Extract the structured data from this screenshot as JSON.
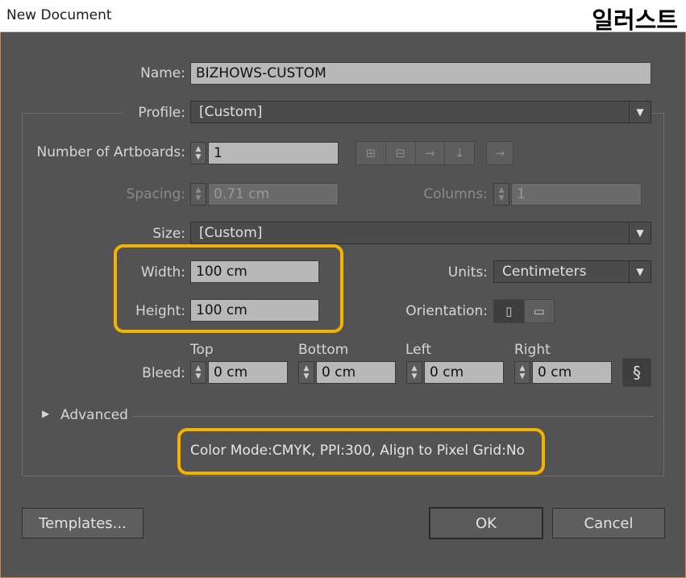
{
  "window": {
    "title": "New Document",
    "brand": "일러스트"
  },
  "name": {
    "label": "Name:",
    "value": "BIZHOWS-CUSTOM"
  },
  "profile": {
    "label": "Profile:",
    "value": "[Custom]"
  },
  "artboards": {
    "label": "Number of Artboards:",
    "value": "1"
  },
  "spacing": {
    "label": "Spacing:",
    "value": "0.71 cm"
  },
  "columns": {
    "label": "Columns:",
    "value": "1"
  },
  "size": {
    "label": "Size:",
    "value": "[Custom]"
  },
  "width": {
    "label": "Width:",
    "value": "100 cm"
  },
  "height": {
    "label": "Height:",
    "value": "100 cm"
  },
  "units": {
    "label": "Units:",
    "value": "Centimeters"
  },
  "orientation": {
    "label": "Orientation:"
  },
  "bleed": {
    "label": "Bleed:",
    "top": {
      "label": "Top",
      "value": "0 cm"
    },
    "bottom": {
      "label": "Bottom",
      "value": "0 cm"
    },
    "left": {
      "label": "Left",
      "value": "0 cm"
    },
    "right": {
      "label": "Right",
      "value": "0 cm"
    }
  },
  "advanced": {
    "label": "Advanced"
  },
  "summary": "Color Mode:CMYK, PPI:300, Align to Pixel Grid:No",
  "buttons": {
    "templates": "Templates...",
    "ok": "OK",
    "cancel": "Cancel"
  },
  "colors": {
    "accent_highlight": "#f5b300",
    "dialog_bg": "#535353"
  },
  "icons": {
    "artboard_layout": [
      "grid-by-row-icon",
      "grid-by-column-icon",
      "arrange-by-row-icon",
      "arrange-by-column-icon"
    ],
    "rtl": "arrow-right-icon",
    "orientation": [
      "portrait-icon",
      "landscape-icon"
    ],
    "bleed_link": "chain-link-icon"
  }
}
